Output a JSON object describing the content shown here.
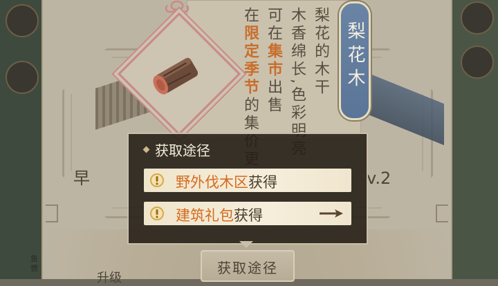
{
  "item": {
    "name": "梨花木",
    "icon": "wood-log-icon"
  },
  "description": {
    "col1": "梨花的木干",
    "col2": "木香绵长,色彩明亮",
    "col3_pre": "可在",
    "col3_hl": "集市",
    "col3_post": "出售",
    "col4_pre": "在",
    "col4_hl": "限定季节",
    "col4_post": "的集价更"
  },
  "background": {
    "left_label": "早",
    "right_label": "v.2",
    "upgrade_label": "升级",
    "tiny_label": "鱼\n惯"
  },
  "popup": {
    "title": "获取途径",
    "sources": [
      {
        "location": "野外伐木区",
        "suffix": "获得",
        "icon": "alert-icon",
        "has_arrow": false
      },
      {
        "location": "建筑礼包",
        "suffix": "获得",
        "icon": "alert-icon",
        "has_arrow": true
      }
    ]
  },
  "bottom_button": {
    "label": "获取途径"
  },
  "colors": {
    "highlight": "#d46a1e",
    "plaque": "#6a84a5"
  }
}
